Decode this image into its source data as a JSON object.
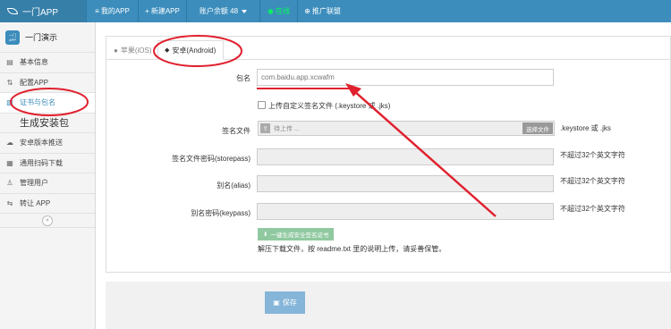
{
  "header": {
    "logo_text": "一门APP",
    "nav": [
      {
        "icon": "≡",
        "label": "我的APP"
      },
      {
        "icon": "+",
        "label": "新建APP"
      },
      {
        "icon": "",
        "label": "账户余额 48"
      },
      {
        "icon": "",
        "label": "在线"
      },
      {
        "icon": "⊕",
        "label": "推广联盟"
      }
    ]
  },
  "sidebar": {
    "app_icon_top": "一门",
    "app_icon_bottom": "APP",
    "app_name": "一门演示",
    "items": [
      {
        "icon": "▤",
        "label": "基本信息"
      },
      {
        "icon": "⇅",
        "label": "配置APP"
      },
      {
        "icon": "▧",
        "label": "证书与包名"
      },
      {
        "icon": "",
        "label": "生成安装包"
      },
      {
        "icon": "☁",
        "label": "安卓版本推送"
      },
      {
        "icon": "▦",
        "label": "通用扫码下载"
      },
      {
        "icon": "♙",
        "label": "管理用户"
      },
      {
        "icon": "⇆",
        "label": "转让 APP"
      }
    ],
    "collapse_icon": "«"
  },
  "tabs": [
    {
      "icon": "",
      "label": "苹果(iOS)"
    },
    {
      "icon": "◆",
      "label": "安卓(Android)"
    }
  ],
  "form": {
    "package_label": "包名",
    "package_value": "com.baidu.app.xcwafm",
    "custom_sign_label": "上传自定义签名文件 (.keystore 或 .jks)",
    "sign_file_label": "签名文件",
    "sign_file_placeholder": "待上传 ...",
    "choose_file_label": "选择文件",
    "sign_file_hint": ".keystore 或 .jks",
    "storepass_label": "签名文件密码(storepass)",
    "storepass_hint": "不超过32个英文字符",
    "alias_label": "别名(alias)",
    "alias_hint": "不超过32个英文字符",
    "keypass_label": "别名密码(keypass)",
    "keypass_hint": "不超过32个英文字符",
    "generate_label": "一键生成安全签名证书",
    "note": "解压下载文件，按 readme.txt 里的说明上传，请妥善保管。"
  },
  "footer": {
    "save_label": "保存"
  },
  "colors": {
    "header": "#3c8dbc",
    "annotation": "#e0202e",
    "online": "#00ff55"
  }
}
